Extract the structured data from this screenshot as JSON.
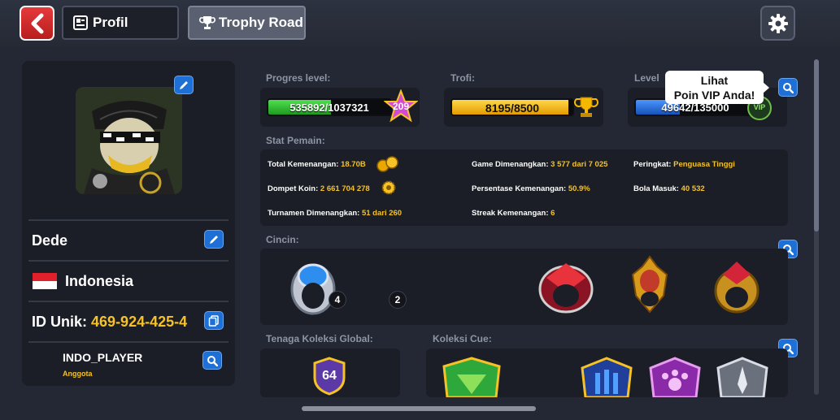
{
  "tabs": {
    "profil": "Profil",
    "trophy_road": "Trophy Road"
  },
  "profile": {
    "name": "Dede",
    "country": "Indonesia",
    "uid_label": "ID Unik:",
    "uid_value": "469-924-425-4",
    "club_name": "INDO_PLAYER",
    "club_role": "Anggota"
  },
  "progress": {
    "level_label": "Progres level:",
    "level_text": "535892/1037321",
    "level_fraction": 0.5166,
    "level_badge": "209",
    "trophy_label": "Trofi:",
    "trophy_text": "8195/8500",
    "trophy_fraction": 0.964,
    "vip_label": "Level",
    "vip_text": "49642/135000",
    "vip_fraction": 0.3677,
    "vip_badge": "VIP"
  },
  "tooltip": {
    "line1": "Lihat",
    "line2": "Poin VIP Anda!"
  },
  "stats": {
    "label": "Stat Pemain:",
    "total_wins_label": "Total Kemenangan:",
    "total_wins_value": "18.70B",
    "wallet_label": "Dompet Koin:",
    "wallet_value": "2 661 704 278",
    "tournament_label": "Turnamen Dimenangkan:",
    "tournament_value": "51 dari 260",
    "games_won_label": "Game Dimenangkan:",
    "games_won_value": "3 577 dari 7 025",
    "win_pct_label": "Persentase Kemenangan:",
    "win_pct_value": "50.9%",
    "streak_label": "Streak Kemenangan:",
    "streak_value": "6",
    "rank_label": "Peringkat:",
    "rank_value": "Penguasa Tinggi",
    "balls_label": "Bola Masuk:",
    "balls_value": "40 532"
  },
  "rings": {
    "label": "Cincin:",
    "count_1": "4",
    "count_2": "2"
  },
  "collection_power": {
    "label": "Tenaga Koleksi Global:",
    "value": "64"
  },
  "cue_collection": {
    "label": "Koleksi Cue:"
  },
  "colors": {
    "level_bar": "#2bc12b",
    "trophy_bar": "#f5b800",
    "vip_bar": "#1f6fe0",
    "accent_yellow": "#f5c227",
    "button_blue": "#1e6fd6"
  },
  "icons": [
    "back-arrow-icon",
    "profile-card-icon",
    "trophy-icon",
    "gear-icon",
    "pencil-icon",
    "copy-icon",
    "search-icon",
    "star-badge-icon",
    "vip-badge-icon",
    "coins-icon",
    "gear-coin-icon",
    "ring-icon",
    "shield-badge-icon"
  ]
}
